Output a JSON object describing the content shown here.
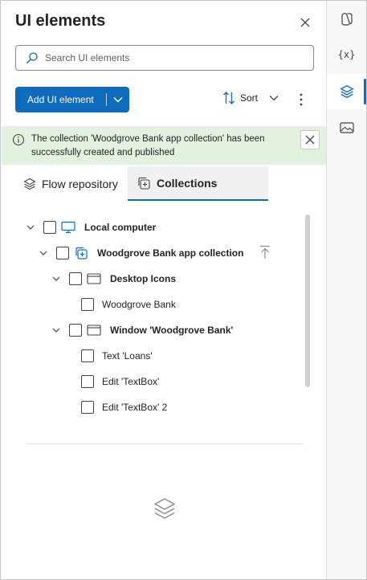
{
  "panel": {
    "title": "UI elements",
    "search_placeholder": "Search UI elements",
    "add_button": "Add UI element",
    "sort_label": "Sort"
  },
  "banner": {
    "message": "The collection 'Woodgrove Bank app collection' has been successfully created and published"
  },
  "tabs": [
    {
      "label": "Flow repository",
      "selected": false
    },
    {
      "label": "Collections",
      "selected": true
    }
  ],
  "tree": {
    "root": {
      "label": "Local computer"
    },
    "collection": {
      "label": "Woodgrove Bank app collection"
    },
    "groups": [
      {
        "label": "Desktop Icons",
        "items": [
          "Woodgrove Bank"
        ]
      },
      {
        "label": "Window 'Woodgrove Bank'",
        "items": [
          "Text 'Loans'",
          "Edit 'TextBox'",
          "Edit 'TextBox' 2"
        ]
      }
    ]
  },
  "rail": {
    "variables_label": "{x}",
    "items": [
      "copilot-icon",
      "variables-icon",
      "ui-elements-icon",
      "images-icon"
    ],
    "active": "ui-elements-icon"
  },
  "colors": {
    "accent": "#0f6cbd",
    "banner_bg": "#e2f2df"
  }
}
